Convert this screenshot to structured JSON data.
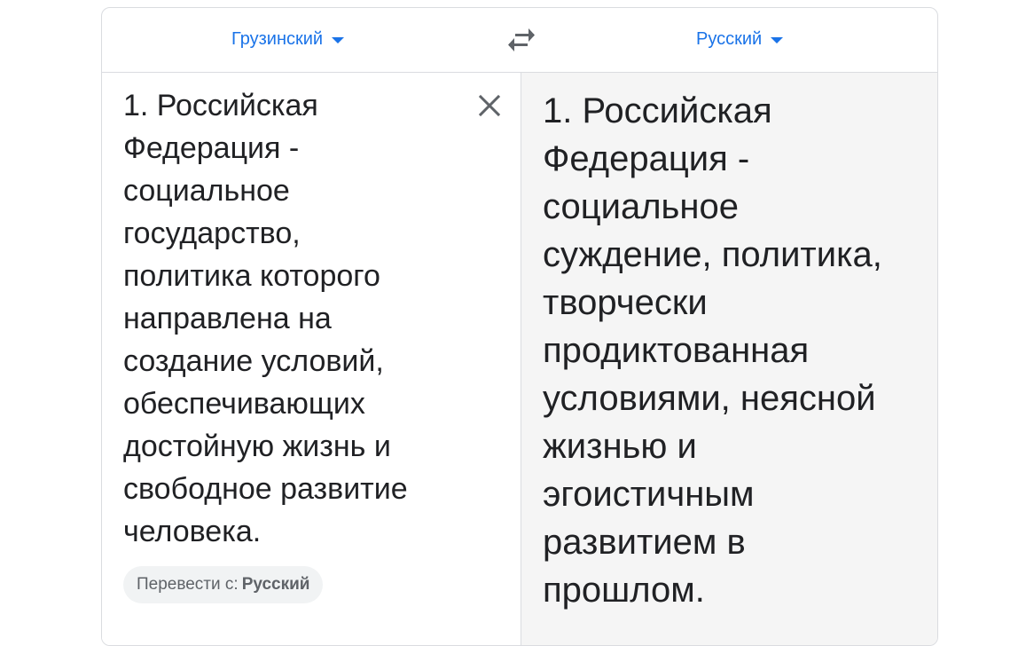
{
  "language_bar": {
    "source_language": "Грузинский",
    "target_language": "Русский",
    "swap_icon": "swap-arrows-icon"
  },
  "source": {
    "text": "1. Российская\nФедерация -\nсоциальное\nгосударство,\nполитика которого\nнаправлена на\nсоздание условий,\nобеспечивающих\nдостойную жизнь и\nсвободное развитие\nчеловека.",
    "clear_icon": "close-icon",
    "detect_prefix": "Перевести с:",
    "detect_language": "Русский"
  },
  "target": {
    "text": "1. Российская\nФедерация -\nсоциальное\nсуждение, политика,\nтворчески\nпродиктованная\nусловиями, неясной\nжизнью и\nэгоистичным\nразвитием в\nпрошлом."
  },
  "colors": {
    "accent": "#1a73e8",
    "icon": "#5f6368",
    "text": "#202124",
    "target_bg": "#f5f5f5",
    "border": "#dadce0"
  }
}
